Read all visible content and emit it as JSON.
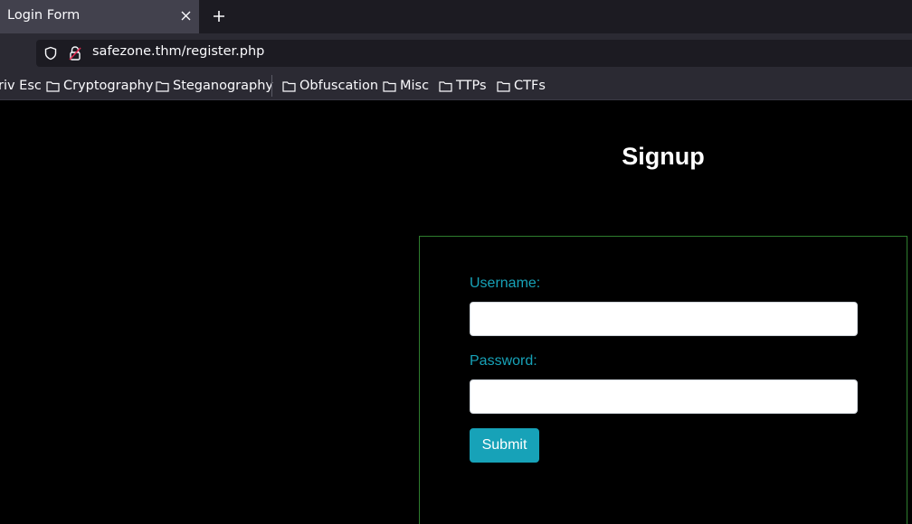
{
  "browser": {
    "tab": {
      "title": "Login Form"
    },
    "url": "safezone.thm/register.php",
    "bookmarks": [
      {
        "label": "riv Esc",
        "icon": "none"
      },
      {
        "label": "Cryptography",
        "icon": "folder-icon"
      },
      {
        "label": "Steganography",
        "icon": "folder-icon"
      },
      {
        "label": "Obfuscation",
        "icon": "folder-icon"
      },
      {
        "label": "Misc",
        "icon": "folder-icon"
      },
      {
        "label": "TTPs",
        "icon": "folder-icon"
      },
      {
        "label": "CTFs",
        "icon": "folder-icon"
      }
    ]
  },
  "page": {
    "heading": "Signup",
    "form": {
      "username_label": "Username:",
      "username_value": "",
      "password_label": "Password:",
      "password_value": "",
      "submit_label": "Submit"
    }
  },
  "colors": {
    "page_background": "#000000",
    "accent": "#17a2b8",
    "form_border": "#2e7d2e",
    "toolbar": "#2b2a33",
    "tab_active": "#42414d"
  }
}
